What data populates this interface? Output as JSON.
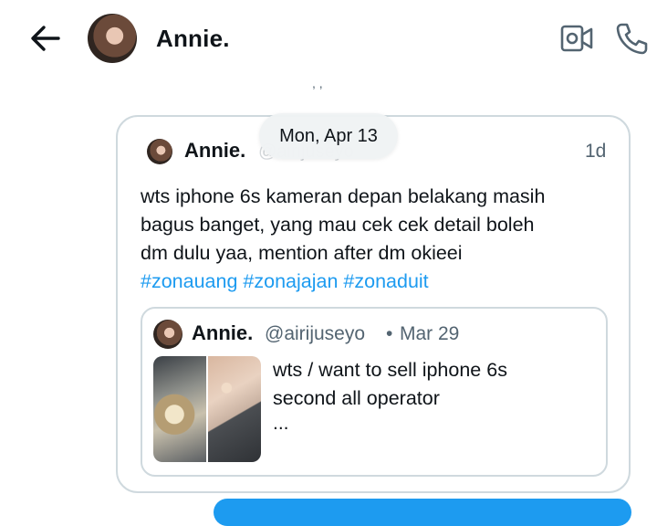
{
  "header": {
    "title": "Annie.",
    "back_icon": "arrow-left-icon",
    "video_icon": "video-camera-icon",
    "phone_icon": "phone-icon"
  },
  "conversation": {
    "clipped_previous_text": ", ,",
    "date_separator": "Mon, Apr 13"
  },
  "shared_tweet": {
    "author_name": "Annie.",
    "author_handle": "@airijuseyo",
    "age": "1d",
    "text_lines": [
      "wts iphone 6s kameran depan belakang masih",
      "bagus banget, yang mau cek cek detail boleh",
      "dm dulu yaa, mention after dm okieei"
    ],
    "hashtags": [
      "#zonauang",
      "#zonajajan",
      "#zonaduit"
    ],
    "quoted": {
      "author_name": "Annie.",
      "author_handle": "@airijuseyo",
      "separator": "•",
      "date": "Mar 29",
      "text_lines": [
        "wts / want to sell iphone 6s",
        "second all operator"
      ],
      "truncation": "..."
    }
  },
  "colors": {
    "link": "#1d9bf0",
    "muted": "#536471",
    "border": "#cfd9de",
    "text": "#0f1419"
  }
}
